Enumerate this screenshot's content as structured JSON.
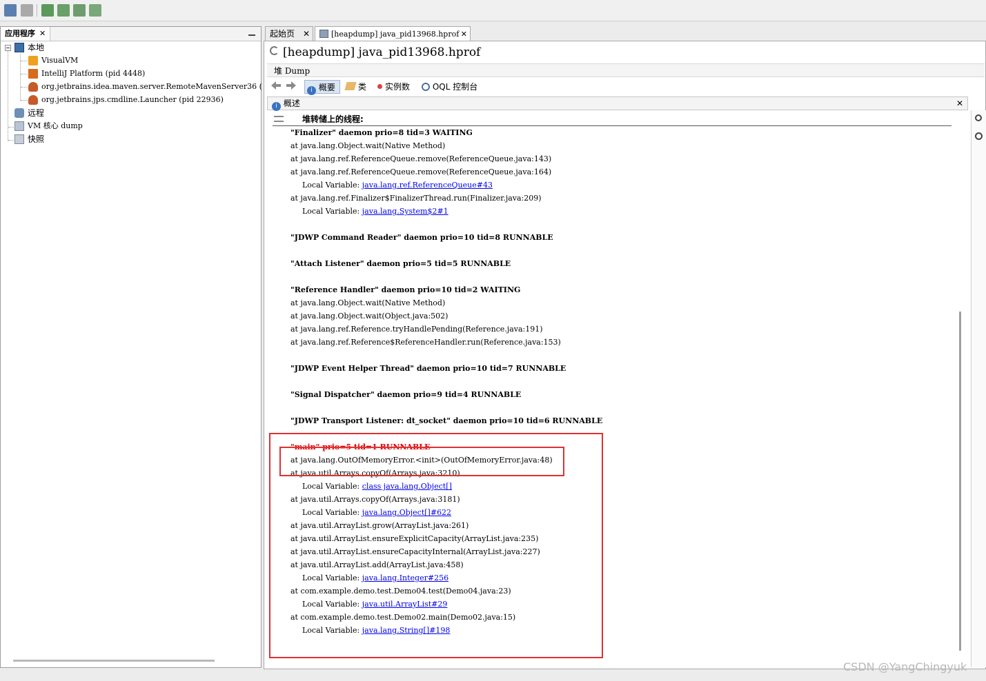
{
  "toolbar": {
    "icons": [
      "open-file-icon",
      "save-icon",
      "add-jmx-icon",
      "heap-dump-icon",
      "thread-dump-icon",
      "snapshot-icon"
    ]
  },
  "left_panel": {
    "tab_label": "应用程序",
    "tab_close": "✕",
    "tree": {
      "local": "本地",
      "local_items": [
        "VisualVM",
        "IntelliJ Platform (pid 4448)",
        "org.jetbrains.idea.maven.server.RemoteMavenServer36 (",
        "org.jetbrains.jps.cmdline.Launcher (pid 22936)"
      ],
      "remote": "远程",
      "vm_core": "VM 核心 dump",
      "snapshot": "快照"
    }
  },
  "doc_tabs": [
    {
      "label": "起始页",
      "close": "✕"
    },
    {
      "label": "[heapdump] java_pid13968.hprof",
      "close": "✕"
    }
  ],
  "heap": {
    "title": "[heapdump]  java_pid13968.hprof",
    "dump_label": "堆 Dump",
    "views": [
      "概要",
      "类",
      "实例数",
      "OQL 控制台"
    ],
    "overview_header": "概述",
    "overview_close": "✕",
    "section_title": "堆转储上的线程:",
    "lines": [
      {
        "text": "\"Finalizer\" daemon prio=8 tid=3 WAITING",
        "kind": "thread"
      },
      {
        "text": "at java.lang.Object.wait(Native Method)",
        "kind": "frame"
      },
      {
        "text": "at java.lang.ref.ReferenceQueue.remove(ReferenceQueue.java:143)",
        "kind": "frame"
      },
      {
        "text": "at java.lang.ref.ReferenceQueue.remove(ReferenceQueue.java:164)",
        "kind": "frame"
      },
      {
        "prefix": "Local Variable: ",
        "link": "java.lang.ref.ReferenceQueue#43",
        "kind": "local"
      },
      {
        "text": "at java.lang.ref.Finalizer$FinalizerThread.run(Finalizer.java:209)",
        "kind": "frame"
      },
      {
        "prefix": "Local Variable: ",
        "link": "java.lang.System$2#1",
        "kind": "local"
      },
      {
        "text": "",
        "kind": "blank"
      },
      {
        "text": "\"JDWP Command Reader\" daemon prio=10 tid=8 RUNNABLE",
        "kind": "thread"
      },
      {
        "text": "",
        "kind": "blank"
      },
      {
        "text": "\"Attach Listener\" daemon prio=5 tid=5 RUNNABLE",
        "kind": "thread"
      },
      {
        "text": "",
        "kind": "blank"
      },
      {
        "text": "\"Reference Handler\" daemon prio=10 tid=2 WAITING",
        "kind": "thread"
      },
      {
        "text": "at java.lang.Object.wait(Native Method)",
        "kind": "frame"
      },
      {
        "text": "at java.lang.Object.wait(Object.java:502)",
        "kind": "frame"
      },
      {
        "text": "at java.lang.ref.Reference.tryHandlePending(Reference.java:191)",
        "kind": "frame"
      },
      {
        "text": "at java.lang.ref.Reference$ReferenceHandler.run(Reference.java:153)",
        "kind": "frame"
      },
      {
        "text": "",
        "kind": "blank"
      },
      {
        "text": "\"JDWP Event Helper Thread\" daemon prio=10 tid=7 RUNNABLE",
        "kind": "thread"
      },
      {
        "text": "",
        "kind": "blank"
      },
      {
        "text": "\"Signal Dispatcher\" daemon prio=9 tid=4 RUNNABLE",
        "kind": "thread"
      },
      {
        "text": "",
        "kind": "blank"
      },
      {
        "text": "\"JDWP Transport Listener: dt_socket\" daemon prio=10 tid=6 RUNNABLE",
        "kind": "thread"
      },
      {
        "text": "",
        "kind": "blank"
      },
      {
        "text": "\"main\" prio=5 tid=1 RUNNABLE",
        "kind": "thread-red"
      },
      {
        "text": "at java.lang.OutOfMemoryError.<init>(OutOfMemoryError.java:48)",
        "kind": "frame"
      },
      {
        "text": "at java.util.Arrays.copyOf(Arrays.java:3210)",
        "kind": "frame"
      },
      {
        "prefix": "Local Variable: ",
        "link": "class java.lang.Object[]",
        "kind": "local"
      },
      {
        "text": "at java.util.Arrays.copyOf(Arrays.java:3181)",
        "kind": "frame"
      },
      {
        "prefix": "Local Variable: ",
        "link": "java.lang.Object[]#622",
        "kind": "local"
      },
      {
        "text": "at java.util.ArrayList.grow(ArrayList.java:261)",
        "kind": "frame"
      },
      {
        "text": "at java.util.ArrayList.ensureExplicitCapacity(ArrayList.java:235)",
        "kind": "frame"
      },
      {
        "text": "at java.util.ArrayList.ensureCapacityInternal(ArrayList.java:227)",
        "kind": "frame"
      },
      {
        "text": "at java.util.ArrayList.add(ArrayList.java:458)",
        "kind": "frame"
      },
      {
        "prefix": "Local Variable: ",
        "link": "java.lang.Integer#256",
        "kind": "local"
      },
      {
        "text": "at com.example.demo.test.Demo04.test(Demo04.java:23)",
        "kind": "frame"
      },
      {
        "prefix": "Local Variable: ",
        "link": "java.util.ArrayList#29",
        "kind": "local"
      },
      {
        "text": "at com.example.demo.test.Demo02.main(Demo02.java:15)",
        "kind": "frame"
      },
      {
        "prefix": "Local Variable: ",
        "link": "java.lang.String[]#198",
        "kind": "local"
      }
    ]
  },
  "colors": {
    "highlight": "#e03030",
    "link": "#0000ee",
    "main_thread": "#e00000"
  },
  "watermark": "CSDN @YangChingyuk"
}
